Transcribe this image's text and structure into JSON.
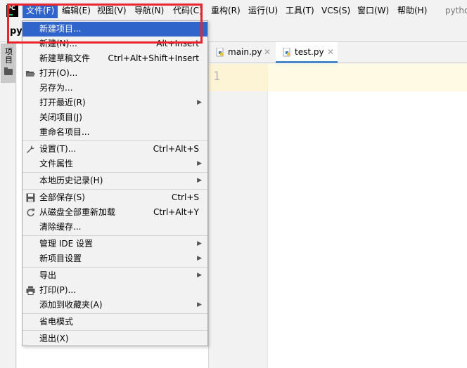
{
  "menubar": {
    "logo": "PC",
    "items": [
      "文件(F)",
      "编辑(E)",
      "视图(V)",
      "导航(N)",
      "代码(C)",
      "重构(R)",
      "运行(U)",
      "工具(T)",
      "VCS(S)",
      "窗口(W)",
      "帮助(H)"
    ],
    "app_title": "pytho"
  },
  "navbar": {
    "project": "pyt"
  },
  "sidebar": {
    "project_tab_label": "项目"
  },
  "editor": {
    "tabs": [
      {
        "label": "main.py",
        "icon": "python-file-icon"
      },
      {
        "label": "test.py",
        "icon": "python-file-icon"
      }
    ],
    "line_numbers": [
      "1"
    ]
  },
  "file_menu": {
    "items": [
      {
        "label": "新建项目...",
        "shortcut": ""
      },
      {
        "label": "新建(N)...",
        "shortcut": "Alt+Insert"
      },
      {
        "label": "新建草稿文件",
        "shortcut": "Ctrl+Alt+Shift+Insert"
      },
      {
        "label": "打开(O)...",
        "shortcut": "",
        "icon": "folder-open-icon"
      },
      {
        "label": "另存为...",
        "shortcut": ""
      },
      {
        "label": "打开最近(R)",
        "shortcut": ""
      },
      {
        "label": "关闭项目(J)",
        "shortcut": ""
      },
      {
        "label": "重命名项目...",
        "shortcut": ""
      },
      {
        "label": "设置(T)...",
        "shortcut": "Ctrl+Alt+S",
        "icon": "wrench-icon"
      },
      {
        "label": "文件属性",
        "shortcut": ""
      },
      {
        "label": "本地历史记录(H)",
        "shortcut": ""
      },
      {
        "label": "全部保存(S)",
        "shortcut": "Ctrl+S",
        "icon": "save-icon"
      },
      {
        "label": "从磁盘全部重新加载",
        "shortcut": "Ctrl+Alt+Y",
        "icon": "reload-icon"
      },
      {
        "label": "清除缓存...",
        "shortcut": ""
      },
      {
        "label": "管理 IDE 设置",
        "shortcut": ""
      },
      {
        "label": "新项目设置",
        "shortcut": ""
      },
      {
        "label": "导出",
        "shortcut": ""
      },
      {
        "label": "打印(P)...",
        "shortcut": "",
        "icon": "print-icon"
      },
      {
        "label": "添加到收藏夹(A)",
        "shortcut": ""
      },
      {
        "label": "省电模式",
        "shortcut": ""
      },
      {
        "label": "退出(X)",
        "shortcut": ""
      }
    ]
  },
  "colors": {
    "menu_highlight": "#2f65ca",
    "annotation_box": "#e8232d",
    "current_line": "#fffae3"
  }
}
